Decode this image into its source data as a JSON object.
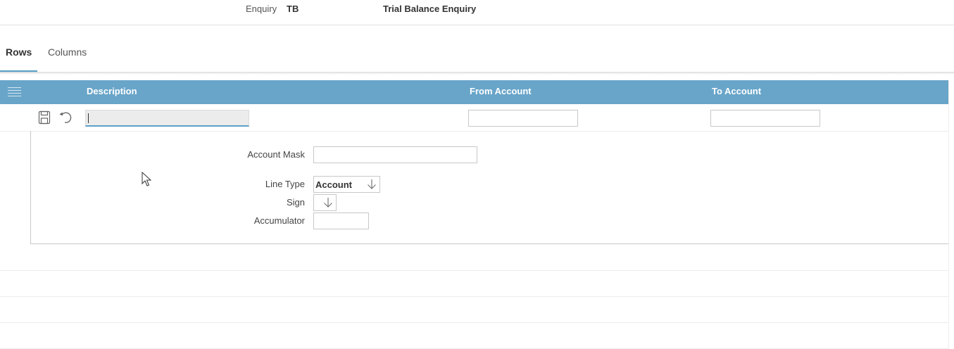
{
  "header": {
    "enquiry_label": "Enquiry",
    "enquiry_code": "TB",
    "enquiry_name": "Trial Balance Enquiry"
  },
  "tabs": [
    {
      "label": "Rows",
      "active": true
    },
    {
      "label": "Columns",
      "active": false
    }
  ],
  "grid": {
    "columns": [
      "Description",
      "From Account",
      "To Account"
    ],
    "header_color": "#69a5c9",
    "edit_row": {
      "description_value": "",
      "from_account_value": "",
      "to_account_value": ""
    },
    "detail": {
      "account_mask_label": "Account Mask",
      "account_mask_value": "",
      "line_type_label": "Line Type",
      "line_type_value": "Account",
      "sign_label": "Sign",
      "sign_value": "",
      "accumulator_label": "Accumulator",
      "accumulator_value": ""
    }
  },
  "accent_color": "#5aa0c8",
  "icons": [
    "menu-icon",
    "save-icon",
    "undo-icon",
    "arrow-down-icon",
    "mouse-pointer-icon"
  ]
}
